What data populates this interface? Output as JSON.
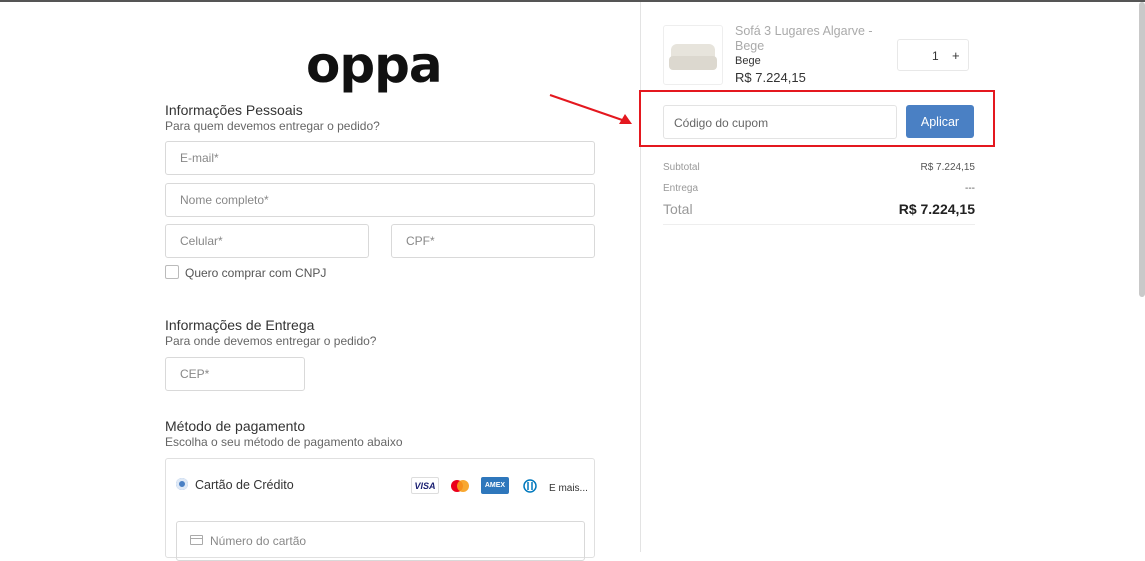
{
  "brand": {
    "logo_text": "oppa"
  },
  "personal": {
    "title": "Informações Pessoais",
    "subtitle": "Para quem devemos entregar o pedido?",
    "email_placeholder": "E-mail*",
    "name_placeholder": "Nome completo*",
    "phone_placeholder": "Celular*",
    "cpf_placeholder": "CPF*",
    "cnpj_checkbox_label": "Quero comprar com CNPJ",
    "cnpj_checked": false
  },
  "delivery": {
    "title": "Informações de Entrega",
    "subtitle": "Para onde devemos entregar o pedido?",
    "cep_placeholder": "CEP*"
  },
  "payment": {
    "title": "Método de pagamento",
    "subtitle": "Escolha o seu método de pagamento abaixo",
    "method_label": "Cartão de Crédito",
    "method_selected": true,
    "card_brands": [
      "VISA",
      "Mastercard",
      "AMEX",
      "Diners"
    ],
    "more_label": "E mais...",
    "card_number_placeholder": "Número do cartão"
  },
  "cart": {
    "product_name": "Sofá 3 Lugares Algarve - Bege",
    "product_variant": "Bege",
    "product_price": "R$ 7.224,15",
    "quantity": "1",
    "plus_label": "+",
    "coupon_placeholder": "Código do cupom",
    "apply_label": "Aplicar"
  },
  "summary": {
    "subtotal_label": "Subtotal",
    "subtotal_value": "R$ 7.224,15",
    "shipping_label": "Entrega",
    "shipping_value": "---",
    "total_label": "Total",
    "total_value": "R$ 7.224,15"
  },
  "colors": {
    "accent": "#4a80c4",
    "annotation": "#e4181f"
  }
}
